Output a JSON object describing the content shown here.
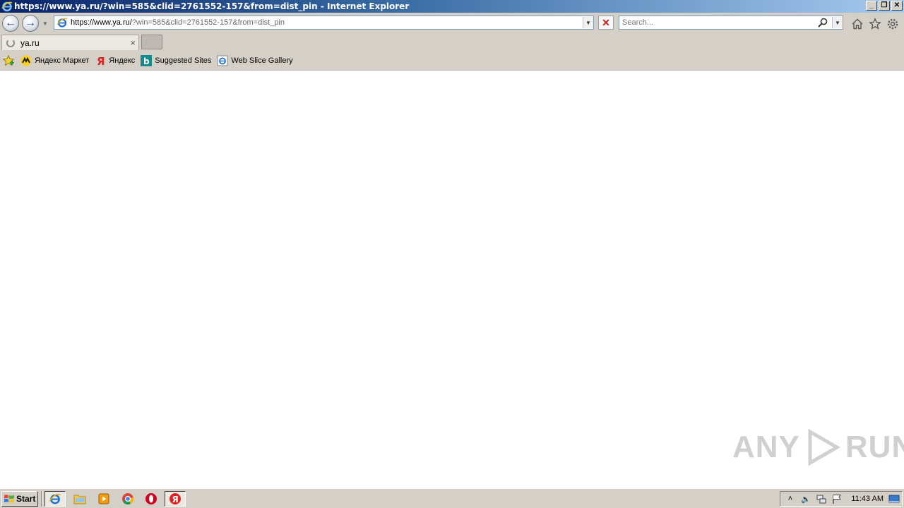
{
  "window": {
    "title": "https://www.ya.ru/?win=585&clid=2761552-157&from=dist_pin - Internet Explorer"
  },
  "navbar": {
    "url_host": "https://www.ya.ru/",
    "url_rest": "?win=585&clid=2761552-157&from=dist_pin",
    "search_placeholder": "Search..."
  },
  "tabs": [
    {
      "label": "ya.ru",
      "close": "×"
    }
  ],
  "favorites": [
    {
      "label": "Яндекс Маркет",
      "icon": "yandex-market-icon"
    },
    {
      "label": "Яндекс",
      "icon": "yandex-icon"
    },
    {
      "label": "Suggested Sites",
      "icon": "bing-icon"
    },
    {
      "label": "Web Slice Gallery",
      "icon": "ie-icon"
    }
  ],
  "watermark": {
    "left": "ANY",
    "right": "RUN"
  },
  "taskbar": {
    "start_label": "Start",
    "apps": [
      "ie-icon",
      "explorer-icon",
      "media-player-icon",
      "chrome-icon",
      "opera-icon",
      "yandex-browser-icon"
    ],
    "clock": "11:43 AM"
  },
  "colors": {
    "chrome_bg": "#d4d0c8",
    "title_start": "#0a246a",
    "title_end": "#a6caf0"
  }
}
